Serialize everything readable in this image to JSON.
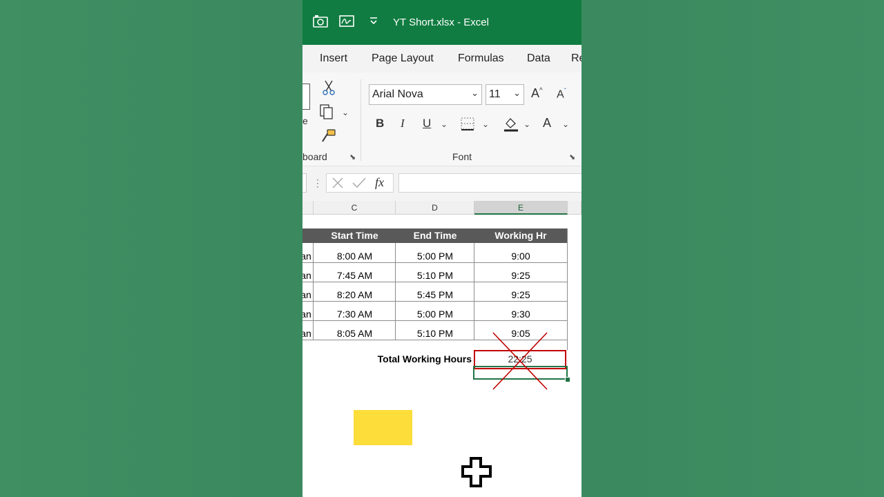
{
  "window": {
    "title": "YT Short.xlsx  -  Excel"
  },
  "quick_access": {
    "icons": [
      "camera-icon",
      "sign-icon",
      "customize-icon"
    ]
  },
  "tabs": [
    "Insert",
    "Page Layout",
    "Formulas",
    "Data",
    "Re"
  ],
  "ribbon": {
    "clipboard": {
      "label": "board",
      "partial_label": "e"
    },
    "font": {
      "label": "Font",
      "font_name": "Arial Nova",
      "font_size": "11",
      "bold": "B",
      "italic": "I",
      "underline": "U",
      "font_color_glyph": "A"
    }
  },
  "formula_bar": {
    "value": "",
    "fx": "fx"
  },
  "columns": [
    "C",
    "D",
    "E"
  ],
  "selected_column": "E",
  "table": {
    "headers": [
      "Start Time",
      "End Time",
      "Working Hr"
    ],
    "rows": [
      {
        "b": "an",
        "start": "8:00 AM",
        "end": "5:00 PM",
        "hr": "9:00"
      },
      {
        "b": "an",
        "start": "7:45 AM",
        "end": "5:10 PM",
        "hr": "9:25"
      },
      {
        "b": "an",
        "start": "8:20 AM",
        "end": "5:45 PM",
        "hr": "9:25"
      },
      {
        "b": "an",
        "start": "7:30 AM",
        "end": "5:00 PM",
        "hr": "9:30"
      },
      {
        "b": "an",
        "start": "8:05 AM",
        "end": "5:10 PM",
        "hr": "9:05"
      }
    ],
    "total_label": "Total Working Hours",
    "total_value": "22:25"
  },
  "colors": {
    "excel_green": "#107c41",
    "header_fill": "#595959",
    "mark_red": "#c00000",
    "highlight_yellow": "#fddd3a"
  }
}
